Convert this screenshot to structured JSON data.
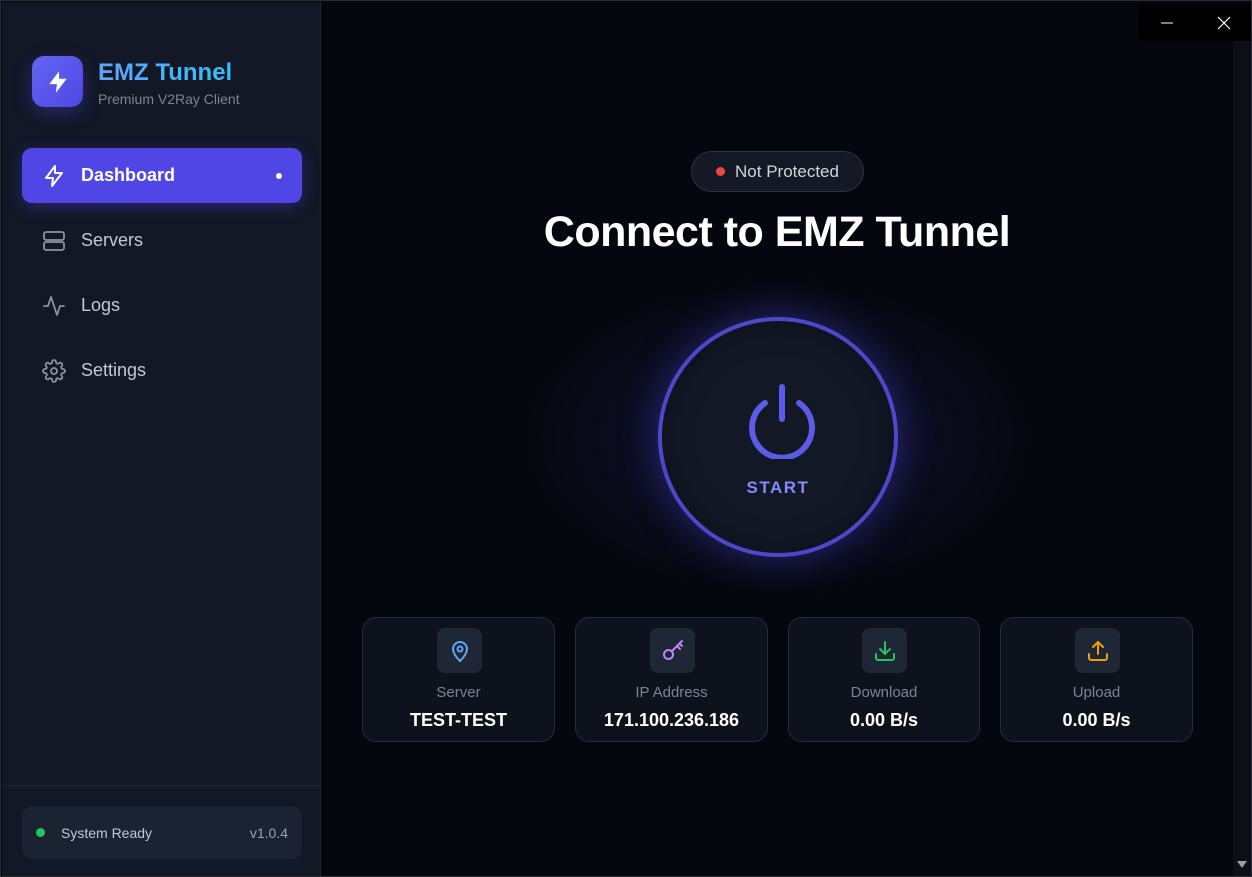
{
  "brand": {
    "title": "EMZ Tunnel",
    "subtitle": "Premium V2Ray Client",
    "icon": "lightning-bolt-icon"
  },
  "sidebar": {
    "items": [
      {
        "label": "Dashboard",
        "icon": "lightning-icon",
        "active": true
      },
      {
        "label": "Servers",
        "icon": "server-icon",
        "active": false
      },
      {
        "label": "Logs",
        "icon": "activity-icon",
        "active": false
      },
      {
        "label": "Settings",
        "icon": "gear-icon",
        "active": false
      }
    ]
  },
  "status": {
    "text": "System Ready",
    "version": "v1.0.4",
    "color": "#22c55e"
  },
  "main": {
    "badge": "Not Protected",
    "badge_color": "#ef4444",
    "headline": "Connect to EMZ Tunnel",
    "power_label": "START"
  },
  "stats": [
    {
      "label": "Server",
      "value": "TEST-TEST",
      "icon": "map-pin-icon",
      "color": "#60a5fa"
    },
    {
      "label": "IP Address",
      "value": "171.100.236.186",
      "icon": "key-icon",
      "color": "#c084fc"
    },
    {
      "label": "Download",
      "value": "0.00 B/s",
      "icon": "download-icon",
      "color": "#22c55e"
    },
    {
      "label": "Upload",
      "value": "0.00 B/s",
      "icon": "upload-icon",
      "color": "#f59e0b"
    }
  ],
  "colors": {
    "accent": "#4f46e5",
    "background": "#05070e",
    "sidebar": "#121826"
  }
}
